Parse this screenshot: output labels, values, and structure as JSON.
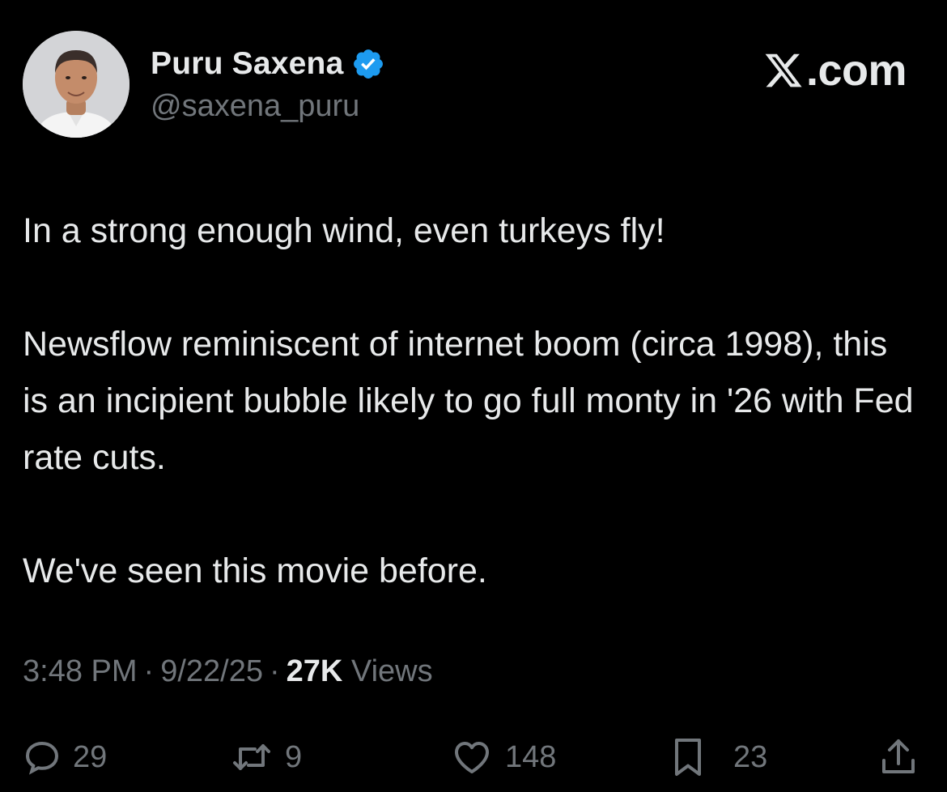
{
  "author": {
    "display_name": "Puru Saxena",
    "handle": "@saxena_puru",
    "verified": true
  },
  "brand": {
    "text": ".com",
    "icon": "x-logo-icon"
  },
  "tweet": {
    "paragraphs": [
      "In a strong enough wind, even turkeys fly!",
      "Newsflow reminiscent of internet boom (circa 1998), this is an incipient bubble likely to go full monty in '26 with Fed rate cuts.",
      "We've seen this movie before."
    ]
  },
  "meta": {
    "time": "3:48 PM",
    "separator": "·",
    "date": "9/22/25",
    "views_count": "27K",
    "views_label": "Views"
  },
  "actions": {
    "replies": "29",
    "reposts": "9",
    "likes": "148",
    "bookmarks": "23"
  },
  "colors": {
    "background": "#000000",
    "text": "#e7e9ea",
    "secondary": "#71767b",
    "verified": "#1d9bf0"
  }
}
